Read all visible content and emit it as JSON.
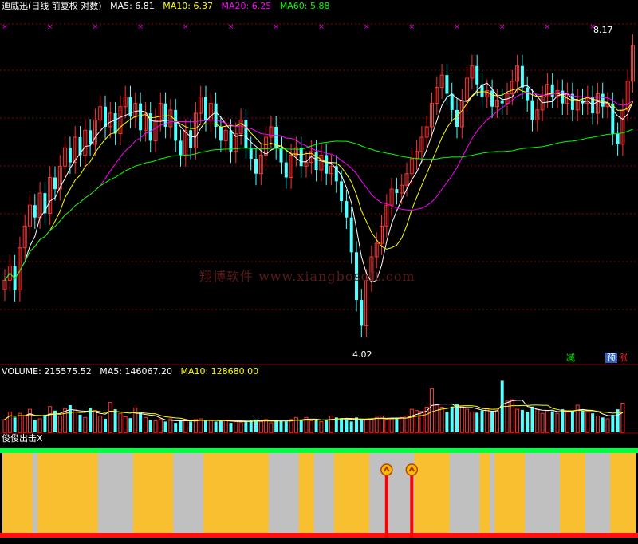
{
  "main_header": {
    "title": "迪威迅(日线 前复权 对数)",
    "ma5": "MA5: 6.81",
    "ma10": "MA10: 6.37",
    "ma20": "MA20: 6.25",
    "ma60": "MA60: 5.88"
  },
  "price_labels": {
    "high": "8.17",
    "low": "4.02"
  },
  "signals": {
    "reduce": "减",
    "pre": "预",
    "rise": "涨"
  },
  "watermark": "翔博软件 www.xiangbosoft.com",
  "volume_header": {
    "volume": "VOLUME: 215575.52",
    "ma5": "MA5: 146067.20",
    "ma10": "MA10: 128680.00"
  },
  "indicator_header": {
    "name": "俊俊出击X"
  },
  "colors": {
    "up": "#ff3232",
    "down": "#54ffff",
    "ma5": "#ffffff",
    "ma10": "#ffff00",
    "ma20": "#ff00ff",
    "ma60": "#00ff00",
    "bg": "#000000",
    "grid": "#8b0000",
    "band_yellow": "#f8c030",
    "band_gray": "#c0c0c0",
    "band_green": "#00ff40"
  },
  "chart_data": {
    "type": "candlestick",
    "title": "迪威迅(日线 前复权 对数)",
    "price_axis": "log",
    "price_range": [
      4.02,
      8.17
    ],
    "close": [
      4.7,
      4.85,
      4.6,
      5.05,
      5.3,
      5.55,
      5.4,
      5.7,
      5.45,
      5.9,
      5.75,
      6.05,
      6.3,
      6.1,
      6.45,
      6.2,
      6.55,
      6.35,
      6.7,
      6.9,
      6.6,
      6.8,
      6.5,
      6.9,
      7.05,
      6.75,
      6.95,
      6.55,
      6.8,
      6.4,
      6.7,
      6.95,
      6.6,
      6.85,
      6.4,
      6.2,
      6.55,
      6.3,
      6.8,
      7.05,
      6.7,
      6.95,
      6.6,
      6.4,
      6.55,
      6.25,
      6.5,
      6.7,
      6.3,
      6.15,
      5.95,
      6.2,
      6.45,
      6.6,
      6.3,
      6.1,
      5.9,
      6.2,
      6.3,
      6.05,
      6.1,
      6.25,
      6.0,
      6.2,
      5.95,
      6.05,
      5.85,
      5.6,
      5.4,
      5.0,
      4.5,
      4.25,
      4.7,
      4.95,
      5.1,
      5.3,
      5.55,
      5.75,
      5.7,
      5.8,
      5.95,
      6.15,
      6.25,
      6.45,
      6.6,
      6.95,
      7.2,
      7.4,
      7.1,
      6.85,
      6.6,
      7.0,
      7.35,
      7.55,
      7.25,
      7.05,
      7.15,
      6.9,
      7.0,
      6.95,
      7.1,
      7.3,
      7.55,
      7.2,
      7.0,
      6.7,
      6.85,
      7.05,
      7.25,
      7.05,
      7.15,
      6.95,
      7.1,
      6.85,
      7.0,
      6.95,
      7.05,
      6.8,
      7.1,
      6.9,
      6.95,
      6.5,
      6.35,
      6.85,
      7.3,
      7.9
    ],
    "volume": [
      95000,
      150000,
      110000,
      140000,
      120000,
      170000,
      90000,
      100000,
      130000,
      190000,
      160000,
      120000,
      175000,
      200000,
      165000,
      130000,
      110000,
      180000,
      160000,
      120000,
      100000,
      220000,
      170000,
      140000,
      115000,
      105000,
      180000,
      150000,
      110000,
      90000,
      85000,
      95000,
      80000,
      100000,
      70000,
      85000,
      90000,
      80000,
      95000,
      100000,
      85000,
      90000,
      80000,
      85000,
      90000,
      70000,
      80000,
      75000,
      85000,
      90000,
      95000,
      80000,
      95000,
      70000,
      90000,
      85000,
      80000,
      95000,
      110000,
      90000,
      110000,
      85000,
      95000,
      80000,
      90000,
      120000,
      110000,
      105000,
      95000,
      80000,
      110000,
      100000,
      95000,
      100000,
      110000,
      120000,
      95000,
      100000,
      105000,
      110000,
      120000,
      170000,
      160000,
      155000,
      185000,
      320000,
      200000,
      185000,
      150000,
      190000,
      210000,
      195000,
      170000,
      150000,
      145000,
      160000,
      175000,
      150000,
      160000,
      380000,
      230000,
      240000,
      170000,
      165000,
      150000,
      190000,
      170000,
      140000,
      160000,
      155000,
      140000,
      170000,
      150000,
      160000,
      200000,
      160000,
      150000,
      140000,
      120000,
      110000,
      100000,
      130000,
      170000,
      215000
    ],
    "ma5_last": 6.81,
    "ma10_last": 6.37,
    "ma20_last": 6.25,
    "ma60_last": 5.88,
    "volume_last": 215575.52,
    "volume_ma5_last": 146067.2,
    "volume_ma10_last": 128680.0,
    "band_pattern": [
      "Y",
      "Y",
      "Y",
      "Y",
      "Y",
      "Y",
      "G",
      "Y",
      "Y",
      "Y",
      "Y",
      "Y",
      "Y",
      "Y",
      "Y",
      "Y",
      "Y",
      "Y",
      "Y",
      "G",
      "G",
      "G",
      "G",
      "G",
      "G",
      "G",
      "Y",
      "Y",
      "Y",
      "Y",
      "Y",
      "Y",
      "Y",
      "Y",
      "G",
      "G",
      "G",
      "G",
      "G",
      "G",
      "Y",
      "Y",
      "Y",
      "Y",
      "Y",
      "Y",
      "Y",
      "Y",
      "Y",
      "Y",
      "Y",
      "Y",
      "Y",
      "G",
      "G",
      "G",
      "G",
      "G",
      "G",
      "Y",
      "Y",
      "Y",
      "G",
      "G",
      "G",
      "G",
      "Y",
      "Y",
      "Y",
      "Y",
      "Y",
      "Y",
      "Y",
      "G",
      "G",
      "G",
      "G",
      "G",
      "G",
      "G",
      "G",
      "G",
      "Y",
      "Y",
      "Y",
      "Y",
      "Y",
      "Y",
      "Y",
      "G",
      "G",
      "G",
      "G",
      "G",
      "G",
      "Y",
      "Y",
      "G",
      "Y",
      "Y",
      "Y",
      "Y",
      "Y",
      "Y",
      "G",
      "G",
      "G",
      "G",
      "G",
      "G",
      "G",
      "Y",
      "Y",
      "Y",
      "Y",
      "Y",
      "G",
      "G",
      "G",
      "G",
      "G",
      "Y",
      "Y",
      "Y",
      "Y",
      "Y",
      "G",
      "G",
      "Y",
      "Y",
      "Y",
      "Y"
    ],
    "buy_signal_indices": [
      76,
      81
    ]
  }
}
